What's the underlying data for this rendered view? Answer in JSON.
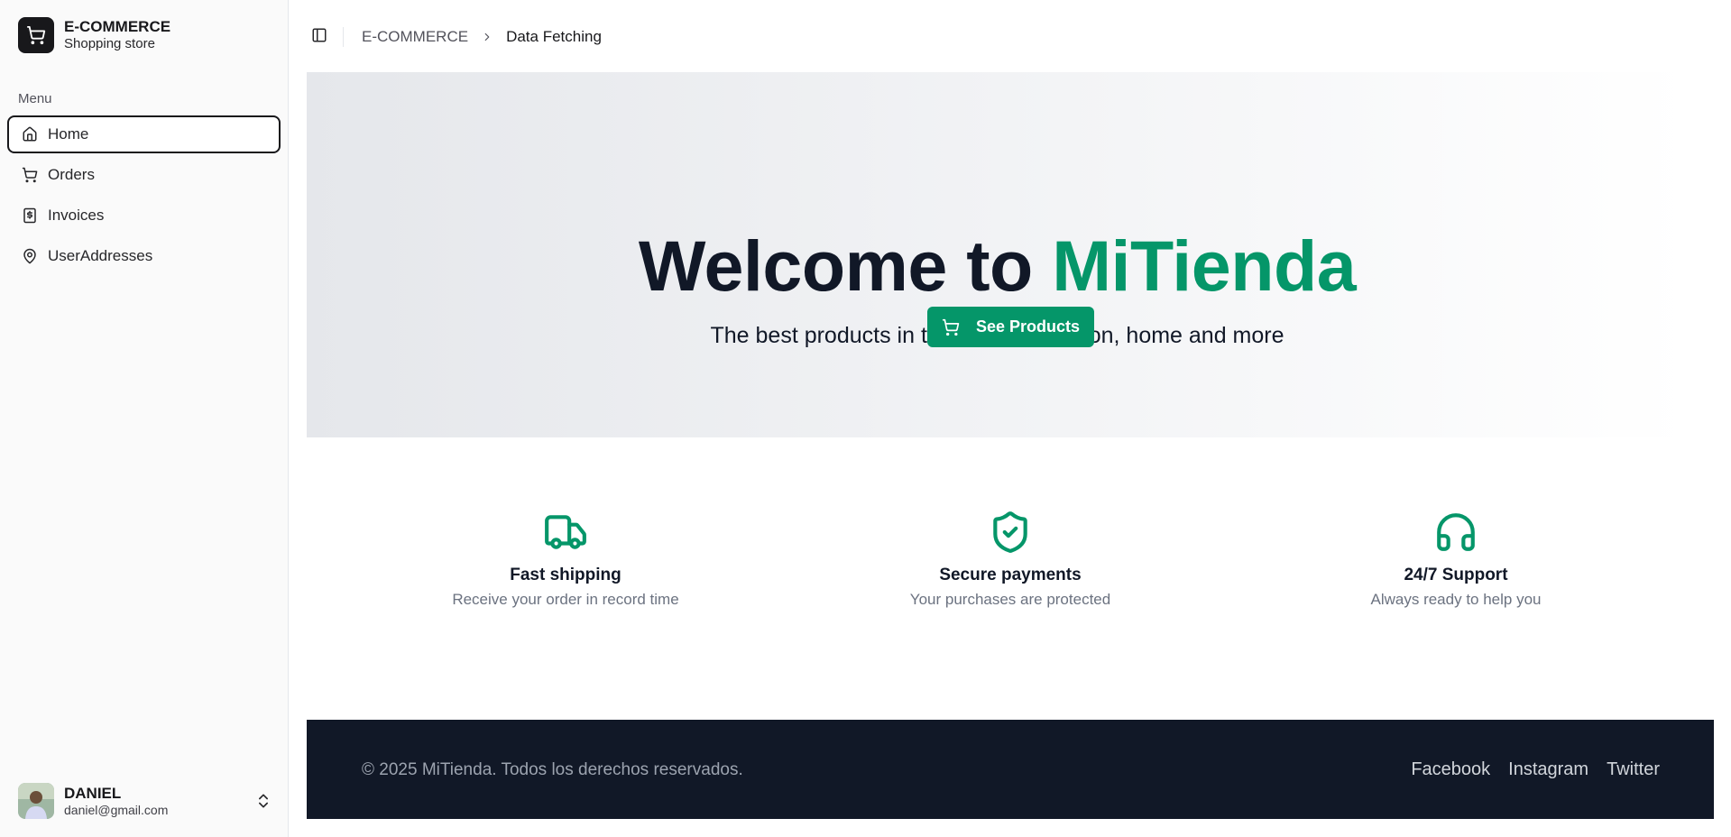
{
  "sidebar": {
    "brand": {
      "title": "E-COMMERCE",
      "subtitle": "Shopping store",
      "icon": "shopping-cart-icon"
    },
    "menu_label": "Menu",
    "items": [
      {
        "label": "Home",
        "icon": "home-icon",
        "active": true
      },
      {
        "label": "Orders",
        "icon": "shopping-cart-icon",
        "active": false
      },
      {
        "label": "Invoices",
        "icon": "dollar-receipt-icon",
        "active": false
      },
      {
        "label": "UserAddresses",
        "icon": "map-pin-icon",
        "active": false
      }
    ],
    "user": {
      "name": "DANIEL",
      "email": "daniel@gmail.com"
    }
  },
  "header": {
    "breadcrumb_root": "E-COMMERCE",
    "breadcrumb_current": "Data Fetching"
  },
  "hero": {
    "title_prefix": "Welcome to",
    "title_brand": "MiTienda",
    "subtitle": "The best products in technology, fashion, home and more",
    "cta_label": "See Products"
  },
  "features": [
    {
      "title": "Fast shipping",
      "description": "Receive your order in record time",
      "icon": "truck-icon"
    },
    {
      "title": "Secure payments",
      "description": "Your purchases are protected",
      "icon": "shield-check-icon"
    },
    {
      "title": "24/7 Support",
      "description": "Always ready to help you",
      "icon": "headphones-icon"
    }
  ],
  "footer": {
    "copyright": "© 2025 MiTienda. Todos los derechos reservados.",
    "links": [
      "Facebook",
      "Instagram",
      "Twitter"
    ]
  },
  "colors": {
    "accent": "#059669",
    "dark": "#111827",
    "sidebar_bg": "#fafafa"
  }
}
